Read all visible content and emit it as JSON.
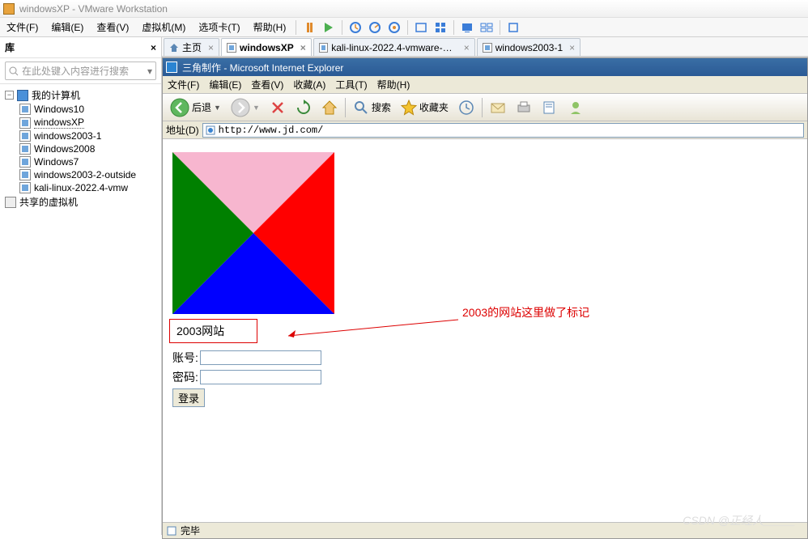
{
  "app": {
    "title": "windowsXP - VMware Workstation"
  },
  "menu": {
    "file": "文件(F)",
    "edit": "编辑(E)",
    "view": "查看(V)",
    "vm": "虚拟机(M)",
    "tabs": "选项卡(T)",
    "help": "帮助(H)"
  },
  "sidebar": {
    "title": "库",
    "search_placeholder": "在此处键入内容进行搜索",
    "nodes": {
      "root": "我的计算机",
      "items": [
        "Windows10",
        "windowsXP",
        "windows2003-1",
        "Windows2008",
        "Windows7",
        "windows2003-2-outside",
        "kali-linux-2022.4-vmw"
      ],
      "shared": "共享的虚拟机"
    }
  },
  "tabs": {
    "home": "主页",
    "t1": "windowsXP",
    "t2": "kali-linux-2022.4-vmware-am...",
    "t3": "windows2003-1"
  },
  "ie": {
    "title": "三角制作 - Microsoft Internet Explorer",
    "menu": {
      "file": "文件(F)",
      "edit": "编辑(E)",
      "view": "查看(V)",
      "fav": "收藏(A)",
      "tools": "工具(T)",
      "help": "帮助(H)"
    },
    "toolbar": {
      "back": "后退",
      "search": "搜索",
      "favorites": "收藏夹"
    },
    "addr_label": "地址(D)",
    "url": "http://www.jd.com/",
    "status": "完毕",
    "page": {
      "site_tag": "2003网站",
      "account_label": "账号:",
      "password_label": "密码:",
      "login_btn": "登录"
    }
  },
  "annotation": "2003的网站这里做了标记",
  "watermark": "CSDN @正经人_____"
}
